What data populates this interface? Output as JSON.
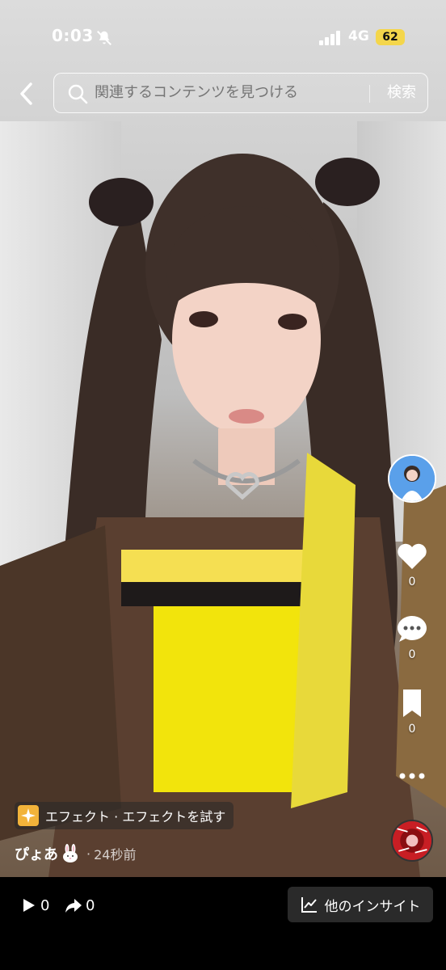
{
  "status_bar": {
    "time": "0:03",
    "network": "4G",
    "battery": "62",
    "icons": [
      "mute-icon",
      "signal-icon"
    ]
  },
  "search": {
    "placeholder": "関連するコンテンツを見つける",
    "button_label": "検索",
    "icons": [
      "back-icon",
      "search-icon"
    ]
  },
  "actions": {
    "likes": "0",
    "comments": "0",
    "saves": "0",
    "icons": [
      "avatar",
      "heart-icon",
      "comment-icon",
      "bookmark-icon",
      "more-icon",
      "music-disc"
    ]
  },
  "post": {
    "effect_label": "エフェクト · エフェクトを試す",
    "author": "ぴょあ",
    "separator": "·",
    "time": "24秒前"
  },
  "bottom_bar": {
    "plays": "0",
    "shares": "0",
    "insight_label": "他のインサイト",
    "icons": [
      "play-icon",
      "share-icon",
      "chart-icon"
    ]
  },
  "colors": {
    "battery": "#f4d64b",
    "accent_yellow": "#f2e40c",
    "background": "#000000"
  }
}
